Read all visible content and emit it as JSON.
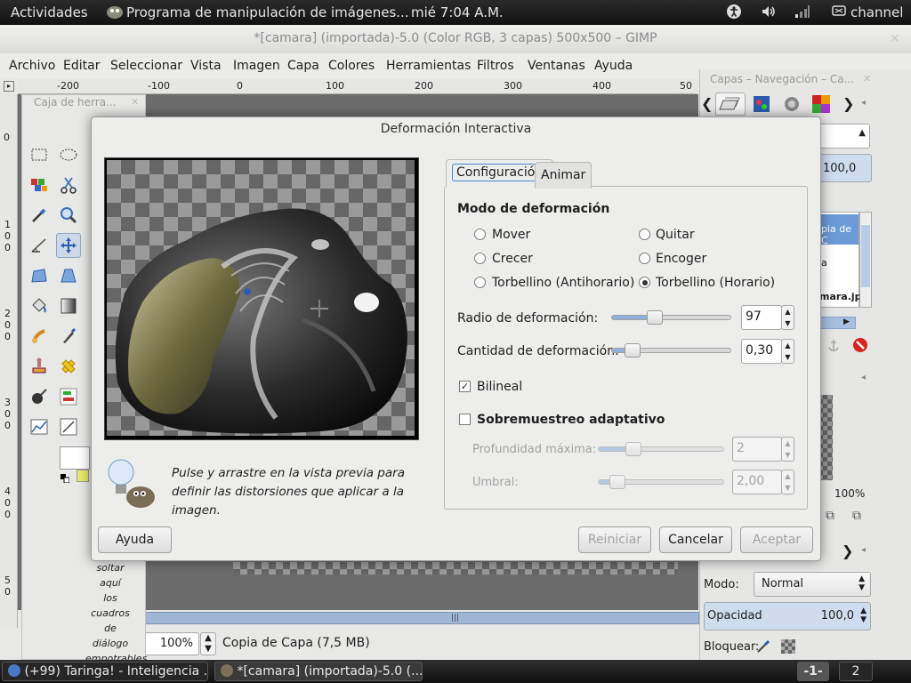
{
  "top_panel": {
    "activities": "Actividades",
    "app_title": "Programa de manipulación de imágenes...",
    "clock": "mié  7:04 A.M.",
    "user": "channel"
  },
  "gimp": {
    "window_title": "*[camara] (importada)-5.0 (Color RGB, 3 capas) 500x500 – GIMP",
    "menu": [
      "Archivo",
      "Editar",
      "Seleccionar",
      "Vista",
      "Imagen",
      "Capa",
      "Colores",
      "Herramientas",
      "Filtros",
      "Ventanas",
      "Ayuda"
    ],
    "ruler_top": [
      "-200",
      "-100",
      "0",
      "100",
      "200",
      "300",
      "400",
      "50"
    ],
    "ruler_left": [
      "0",
      "1 0 0",
      "2 0 0",
      "3 0 0",
      "4 0 0",
      "5 0"
    ],
    "zoom": "100%",
    "layer_info": "Copia de Capa (7,5 MB)"
  },
  "toolbox": {
    "title": "Caja de herra...",
    "drop_hint": [
      "soltar",
      "aquí",
      "los",
      "cuadros",
      "de",
      "diálogo",
      "empotrables"
    ]
  },
  "dock": {
    "title": "Capas – Navegación – Ca...",
    "value_top": "100,0",
    "layer_label_1": "pia de C",
    "layer_label_2": "a",
    "layer_label_3": "mara.jpg",
    "zoom": "100%",
    "mode_label": "Modo:",
    "mode_value": "Normal",
    "opacity_label": "Opacidad",
    "opacity_value": "100,0",
    "lock_label": "Bloquear:"
  },
  "dialog": {
    "title": "Deformación Interactiva",
    "hint": "Pulse y arrastre en la vista previa para definir las distorsiones que aplicar a la imagen.",
    "tabs": [
      "Configuración",
      "Animar"
    ],
    "mode_heading": "Modo de deformación",
    "modes": [
      {
        "label": "Mover",
        "selected": false
      },
      {
        "label": "Quitar",
        "selected": false
      },
      {
        "label": "Crecer",
        "selected": false
      },
      {
        "label": "Encoger",
        "selected": false
      },
      {
        "label": "Torbellino (Antihorario)",
        "selected": false
      },
      {
        "label": "Torbellino (Horario)",
        "selected": true
      }
    ],
    "radius_label": "Radio de deformación:",
    "radius_value": "97",
    "radius_fraction": 0.34,
    "amount_label": "Cantidad de deformación:",
    "amount_value": "0,30",
    "amount_fraction": 0.12,
    "bilinear_label": "Bilineal",
    "bilinear_checked": true,
    "supersample_label": "Sobremuestreo adaptativo",
    "supersample_checked": false,
    "max_depth_label": "Profundidad máxima:",
    "max_depth_value": "2",
    "threshold_label": "Umbral:",
    "threshold_value": "2,00",
    "buttons": {
      "help": "Ayuda",
      "reset": "Reiniciar",
      "cancel": "Cancelar",
      "ok": "Aceptar"
    }
  },
  "taskbar": {
    "task1": "(+99) Taringa! - Inteligencia ...",
    "task2": "*[camara] (importada)-5.0 (...",
    "workspace1": "-1-",
    "workspace2": "2"
  }
}
